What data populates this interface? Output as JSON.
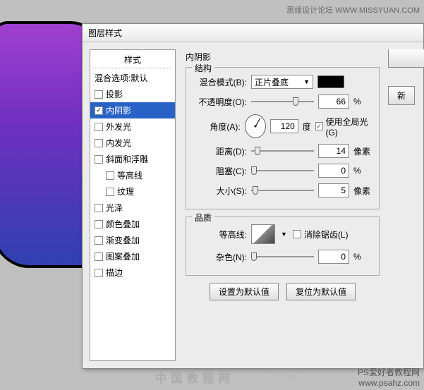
{
  "watermark_top": "思缘设计论坛  WWW.MISSYUAN.COM",
  "dialog_title": "图层样式",
  "styles": {
    "header": "样式",
    "items": [
      {
        "label": "混合选项:默认",
        "checked": null,
        "indent": false
      },
      {
        "label": "投影",
        "checked": false,
        "indent": false
      },
      {
        "label": "内阴影",
        "checked": true,
        "indent": false,
        "selected": true
      },
      {
        "label": "外发光",
        "checked": false,
        "indent": false
      },
      {
        "label": "内发光",
        "checked": false,
        "indent": false
      },
      {
        "label": "斜面和浮雕",
        "checked": false,
        "indent": false
      },
      {
        "label": "等高线",
        "checked": false,
        "indent": true
      },
      {
        "label": "纹理",
        "checked": false,
        "indent": true
      },
      {
        "label": "光泽",
        "checked": false,
        "indent": false
      },
      {
        "label": "颜色叠加",
        "checked": false,
        "indent": false
      },
      {
        "label": "渐变叠加",
        "checked": false,
        "indent": false
      },
      {
        "label": "图案叠加",
        "checked": false,
        "indent": false
      },
      {
        "label": "描边",
        "checked": false,
        "indent": false
      }
    ]
  },
  "section_title": "内阴影",
  "structure": {
    "legend": "结构",
    "blend_mode_label": "混合模式(B):",
    "blend_mode_value": "正片叠底",
    "color": "#000000",
    "opacity_label": "不透明度(O):",
    "opacity_value": "66",
    "opacity_unit": "%",
    "angle_label": "角度(A):",
    "angle_value": "120",
    "angle_unit": "度",
    "global_light_label": "使用全局光(G)",
    "global_light_checked": true,
    "distance_label": "距离(D):",
    "distance_value": "14",
    "distance_unit": "像素",
    "choke_label": "阻塞(C):",
    "choke_value": "0",
    "choke_unit": "%",
    "size_label": "大小(S):",
    "size_value": "5",
    "size_unit": "像素"
  },
  "quality": {
    "legend": "品质",
    "contour_label": "等高线:",
    "antialias_label": "消除锯齿(L)",
    "antialias_checked": false,
    "noise_label": "杂色(N):",
    "noise_value": "0",
    "noise_unit": "%"
  },
  "buttons": {
    "set_default": "设置为默认值",
    "reset_default": "复位为默认值"
  },
  "side": {
    "new": "新"
  },
  "wm_bottom_line1": "PS爱好者教程网",
  "wm_bottom_line2": "www.psahz.com",
  "wm_center": "中 国 教 程 网",
  "wm_left": "JCW"
}
